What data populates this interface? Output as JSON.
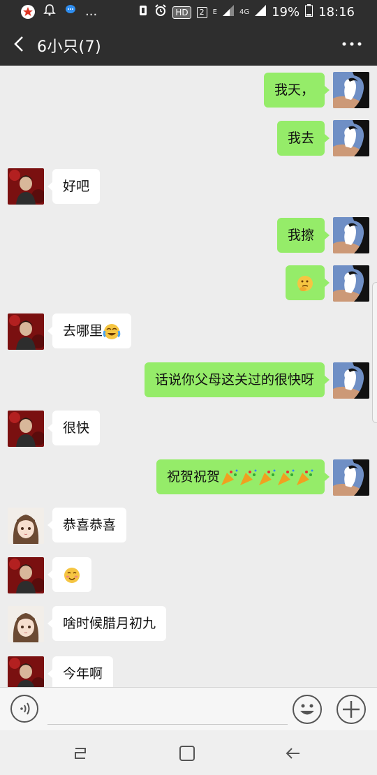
{
  "status_bar": {
    "battery": "19%",
    "time": "18:16",
    "hd": "HD",
    "sim": "2",
    "network_e": "E",
    "network_4g": "4G",
    "more": "..."
  },
  "header": {
    "title": "6小只(7)"
  },
  "messages": [
    {
      "side": "right",
      "text": "我天，"
    },
    {
      "side": "right",
      "text": "我去"
    },
    {
      "side": "left",
      "avatar": "red-avatar",
      "text": "好吧"
    },
    {
      "side": "right",
      "text": "我擦"
    },
    {
      "side": "right",
      "text": "",
      "emoji": "thinking-emoji"
    },
    {
      "side": "left",
      "avatar": "red-avatar",
      "text": "去哪里",
      "emoji": "laughing-crying-emoji"
    },
    {
      "side": "right",
      "text": "话说你父母这关过的很快呀"
    },
    {
      "side": "left",
      "avatar": "red-avatar",
      "text": "很快"
    },
    {
      "side": "right",
      "text": "祝贺祝贺",
      "emoji": "party-popper-emoji x5"
    },
    {
      "side": "left",
      "avatar": "girl-avatar",
      "text": "恭喜恭喜"
    },
    {
      "side": "left",
      "avatar": "red-avatar",
      "text": "",
      "emoji": "blush-emoji"
    },
    {
      "side": "left",
      "avatar": "girl-avatar",
      "text": "啥时候腊月初九"
    },
    {
      "side": "left",
      "avatar": "red-avatar",
      "text": "今年啊"
    }
  ],
  "colors": {
    "header_bg": "#2e2e2e",
    "chat_bg": "#ededed",
    "bubble_self": "#95ec69",
    "bubble_other": "#ffffff"
  },
  "input": {
    "value": "",
    "placeholder": ""
  }
}
